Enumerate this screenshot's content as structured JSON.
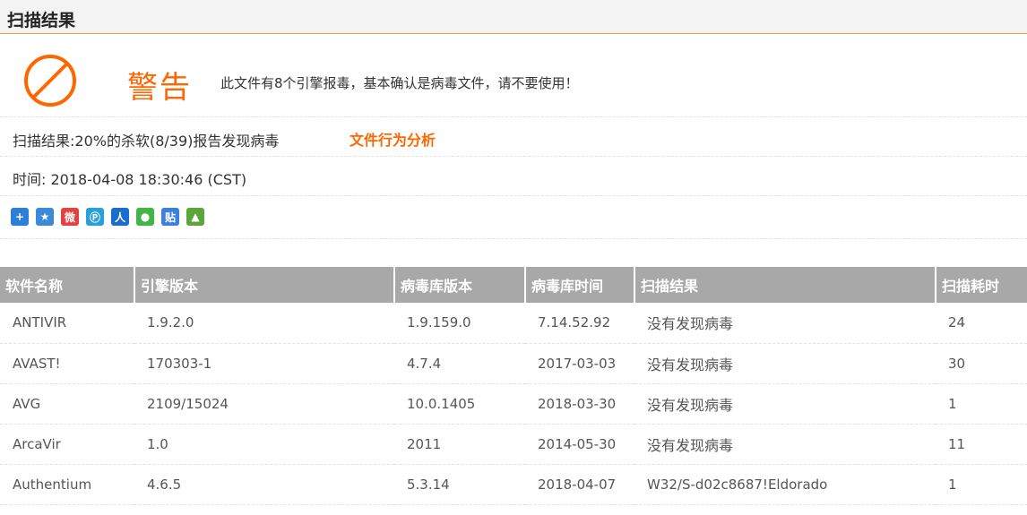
{
  "header": {
    "title": "扫描结果"
  },
  "warning": {
    "label": "警告",
    "message": "此文件有8个引擎报毒，基本确认是病毒文件，请不要使用！",
    "icon": "ban-icon",
    "color": "#ff6600"
  },
  "summary": {
    "scan_result": "扫描结果:20%的杀软(8/39)报告发现病毒",
    "behavior_link": "文件行为分析",
    "time": "时间: 2018-04-08 18:30:46 (CST)"
  },
  "share": [
    {
      "name": "share-more-icon",
      "glyph": "+",
      "color": "#2c7fd6"
    },
    {
      "name": "share-qzone-icon",
      "glyph": "★",
      "color": "#3b8ad8"
    },
    {
      "name": "share-weibo-icon",
      "glyph": "微",
      "color": "#e64141"
    },
    {
      "name": "share-tqq-icon",
      "glyph": "Ⓟ",
      "color": "#2aa0d8"
    },
    {
      "name": "share-renren-icon",
      "glyph": "人",
      "color": "#1a6dcc"
    },
    {
      "name": "share-wechat-icon",
      "glyph": "●",
      "color": "#43b548"
    },
    {
      "name": "share-tieba-icon",
      "glyph": "贴",
      "color": "#3d7fe0"
    },
    {
      "name": "share-image-icon",
      "glyph": "▲",
      "color": "#5aa63a"
    }
  ],
  "table": {
    "headers": [
      "软件名称",
      "引擎版本",
      "病毒库版本",
      "病毒库时间",
      "扫描结果",
      "扫描耗时"
    ],
    "rows": [
      {
        "name": "ANTIVIR",
        "engine": "1.9.2.0",
        "db": "1.9.159.0",
        "db_time": "7.14.52.92",
        "result": "没有发现病毒",
        "status": "clean",
        "duration": "24"
      },
      {
        "name": "AVAST!",
        "engine": "170303-1",
        "db": "4.7.4",
        "db_time": "2017-03-03",
        "result": "没有发现病毒",
        "status": "clean",
        "duration": "30"
      },
      {
        "name": "AVG",
        "engine": "2109/15024",
        "db": "10.0.1405",
        "db_time": "2018-03-30",
        "result": "没有发现病毒",
        "status": "clean",
        "duration": "1"
      },
      {
        "name": "ArcaVir",
        "engine": "1.0",
        "db": "2011",
        "db_time": "2014-05-30",
        "result": "没有发现病毒",
        "status": "clean",
        "duration": "11"
      },
      {
        "name": "Authentium",
        "engine": "4.6.5",
        "db": "5.3.14",
        "db_time": "2018-04-07",
        "result": "W32/S-d02c8687!Eldorado",
        "status": "infected",
        "duration": "1"
      }
    ]
  },
  "colors": {
    "accent": "#ff6600",
    "clean": "#1a9a1a",
    "infected": "#d62828",
    "header_bg": "#a8a8a8"
  }
}
